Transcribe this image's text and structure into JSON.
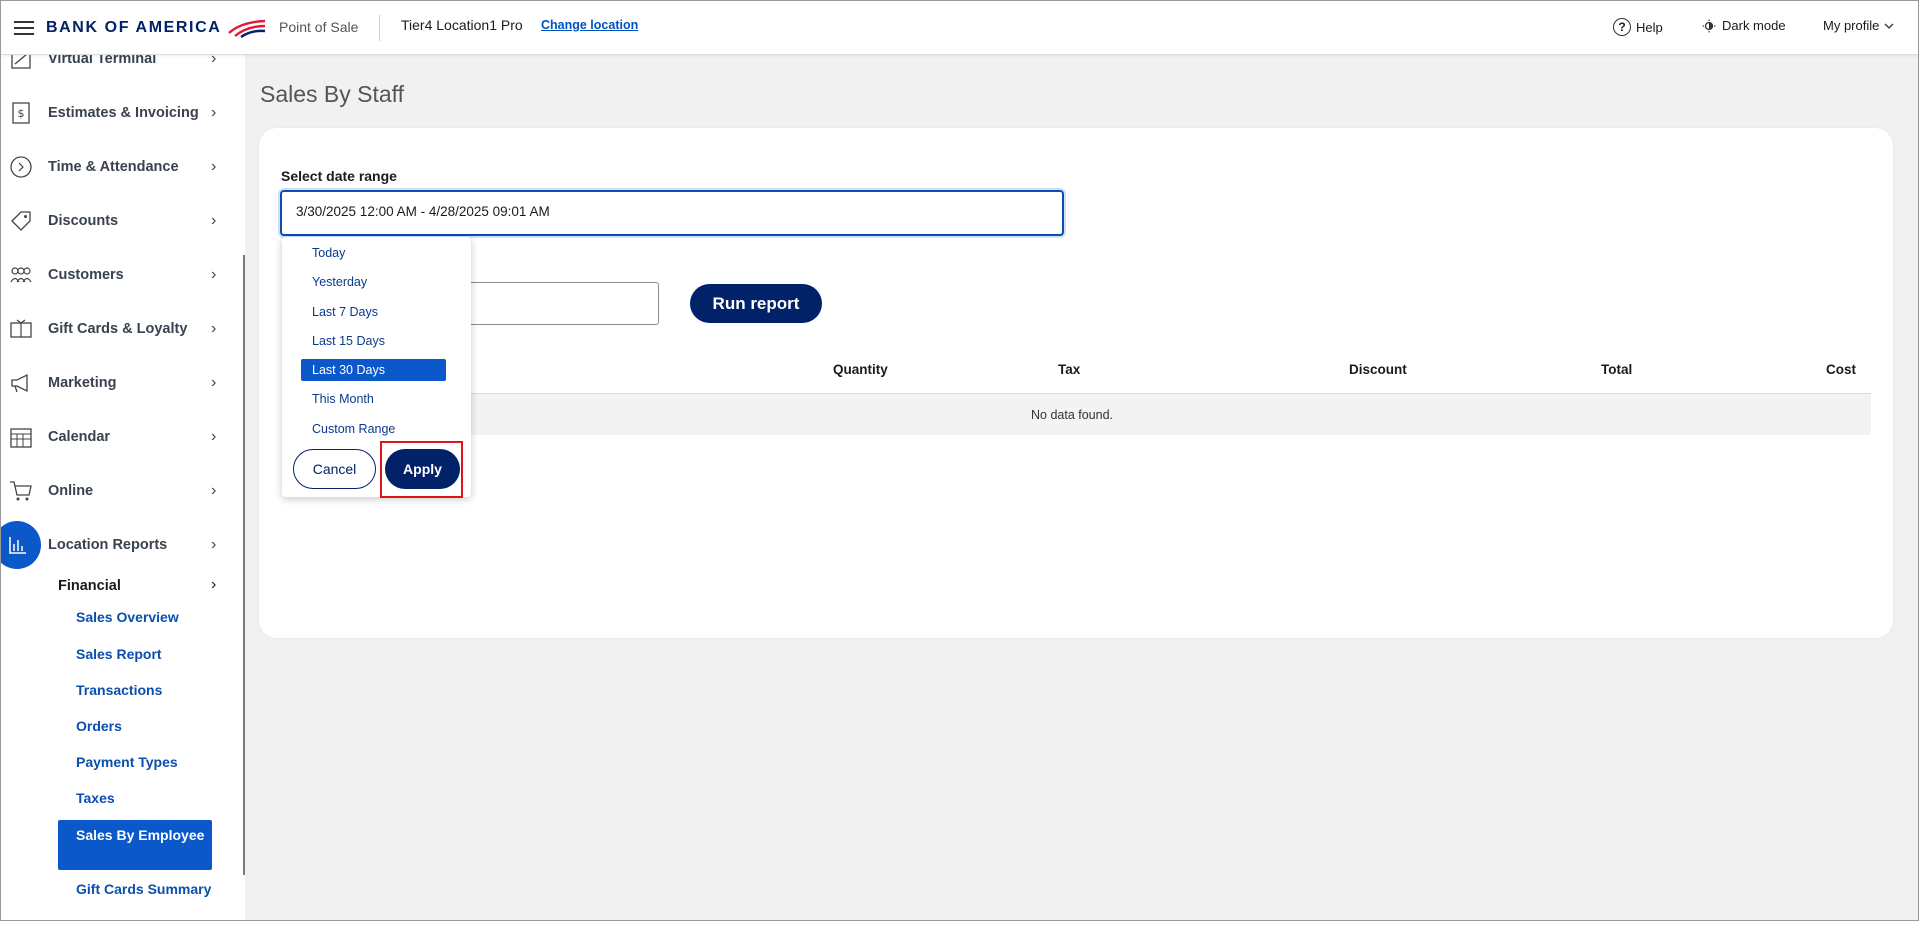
{
  "header": {
    "brand": "BANK OF AMERICA",
    "app_name": "Point of Sale",
    "location": "Tier4 Location1 Pro",
    "change_location": "Change location",
    "help": "Help",
    "dark_mode": "Dark mode",
    "profile": "My profile"
  },
  "sidebar": {
    "items": [
      {
        "label": "Virtual Terminal",
        "icon": "terminal-icon"
      },
      {
        "label": "Estimates & Invoicing",
        "icon": "invoice-icon"
      },
      {
        "label": "Time & Attendance",
        "icon": "clock-icon"
      },
      {
        "label": "Discounts",
        "icon": "tag-icon"
      },
      {
        "label": "Customers",
        "icon": "people-icon"
      },
      {
        "label": "Gift Cards & Loyalty",
        "icon": "gift-card-icon"
      },
      {
        "label": "Marketing",
        "icon": "megaphone-icon"
      },
      {
        "label": "Calendar",
        "icon": "calendar-icon"
      },
      {
        "label": "Online",
        "icon": "cart-icon"
      },
      {
        "label": "Location Reports",
        "icon": "bar-chart-icon"
      }
    ],
    "financial_label": "Financial",
    "financial_items": [
      "Sales Overview",
      "Sales Report",
      "Transactions",
      "Orders",
      "Payment Types",
      "Taxes"
    ],
    "active_item": "Sales By Employee",
    "after_active": "Gift Cards Summary"
  },
  "main": {
    "title": "Sales By Staff",
    "date_label": "Select date range",
    "date_value": "3/30/2025 12:00 AM - 4/28/2025 09:01 AM",
    "run_report": "Run report",
    "columns": [
      "Quantity",
      "Tax",
      "Discount",
      "Total",
      "Cost"
    ],
    "no_data": "No data found."
  },
  "dropdown": {
    "ranges": [
      "Today",
      "Yesterday",
      "Last 7 Days",
      "Last 15 Days",
      "Last 30 Days",
      "This Month",
      "Custom Range"
    ],
    "selected": "Last 30 Days",
    "cancel": "Cancel",
    "apply": "Apply"
  },
  "colors": {
    "brand_navy": "#012169",
    "accent_blue": "#0a58ca",
    "highlight_red": "#e0131a"
  }
}
